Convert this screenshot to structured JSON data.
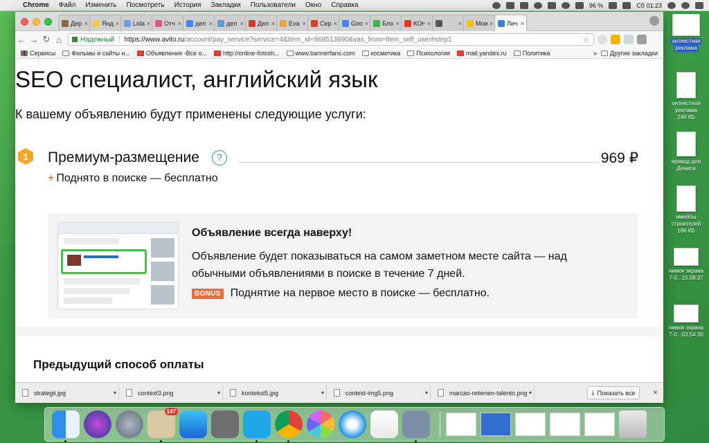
{
  "menubar": {
    "app_name": "Chrome",
    "items": [
      "Файл",
      "Изменить",
      "Посмотреть",
      "История",
      "Закладки",
      "Пользователи",
      "Окно",
      "Справка"
    ],
    "battery": "96 %",
    "time": "Сб 01:23"
  },
  "tabs": [
    {
      "label": "Дер",
      "color": "#8a6a3c"
    },
    {
      "label": "Янд",
      "color": "#f2c94c"
    },
    {
      "label": "Lida",
      "color": "#6aa0e0"
    },
    {
      "label": "Отч",
      "color": "#d65a8c"
    },
    {
      "label": "дел",
      "color": "#4285f4"
    },
    {
      "label": "дел",
      "color": "#5a9bd8"
    },
    {
      "label": "Дел",
      "color": "#d83a2a"
    },
    {
      "label": "Eva",
      "color": "#e8a23a"
    },
    {
      "label": "Сер",
      "color": "#d8402a"
    },
    {
      "label": "Goo",
      "color": "#4285f4"
    },
    {
      "label": "Бло",
      "color": "#3fb24b"
    },
    {
      "label": "КОН",
      "color": "#e0362c"
    },
    {
      "label": "",
      "color": "#555555"
    },
    {
      "label": "Мои",
      "color": "#f2c300"
    },
    {
      "label": "Лич",
      "color": "#3a7fd8"
    }
  ],
  "toolbar": {
    "secure_label": "Надежный",
    "url_main": "https://www.avito.ru",
    "url_rest": "/account/pay_service?service=4&item_id=868513690&vas_from=item_self_user#step1"
  },
  "bookmarks": {
    "items": [
      "Сервисы",
      "Фильмы и сайты н...",
      "Объявления -Все о...",
      "http://online-fotosh...",
      "www.bannerfans.com",
      "косметика",
      "Психология",
      "mail.yandex.ru",
      "Политика"
    ],
    "more": "Другие закладки"
  },
  "page": {
    "title": "SEO специалист, английский язык",
    "intro": "К вашему объявлению будут применены следующие услуги:",
    "service": {
      "number": "1",
      "name": "Премиум-размещение",
      "help": "?",
      "price": "969 ₽",
      "free_plus": "+",
      "free_text": "Поднято в поиске — бесплатно"
    },
    "info": {
      "title": "Объявление всегда наверху!",
      "description": "Объявление будет показываться на самом заметном месте сайта — над обычными объявлениями в поиске в течение 7 дней.",
      "bonus_badge": "BONUS",
      "bonus_text": "Поднятие на первое место в поиске — бесплатно."
    },
    "prev_payment_title": "Предыдущий способ оплаты"
  },
  "downloads": {
    "files": [
      "strategii.jpg",
      "context3.png",
      "kontekst5.jpg",
      "context-img5.png",
      "marcas-retienen-talento.png"
    ],
    "show_all": "Показать все"
  },
  "desktop_icons": [
    {
      "label1": "онтекстная",
      "label2": "реклама",
      "size": ""
    },
    {
      "label1": "онтекстная",
      "label2": "реклама",
      "size": "246 КБ"
    },
    {
      "label1": "еревод для",
      "label2": "Дениса",
      "size": ""
    },
    {
      "label1": "имейлы",
      "label2": "строителей",
      "size": "186 КБ"
    },
    {
      "label1": "нимок экрана",
      "label2": "7-0...15.08.37",
      "size": ""
    },
    {
      "label1": "нимок экрана",
      "label2": "7-0...03.54.30",
      "size": ""
    }
  ],
  "dock": {
    "mail_badge": "147"
  },
  "colors": {
    "accent_blue": "#2e8ce0",
    "badge_orange": "#f5a623",
    "bonus_orange": "#ef6d3c",
    "highlight_green": "#3fc245",
    "secure_green": "#1a7f2e"
  }
}
